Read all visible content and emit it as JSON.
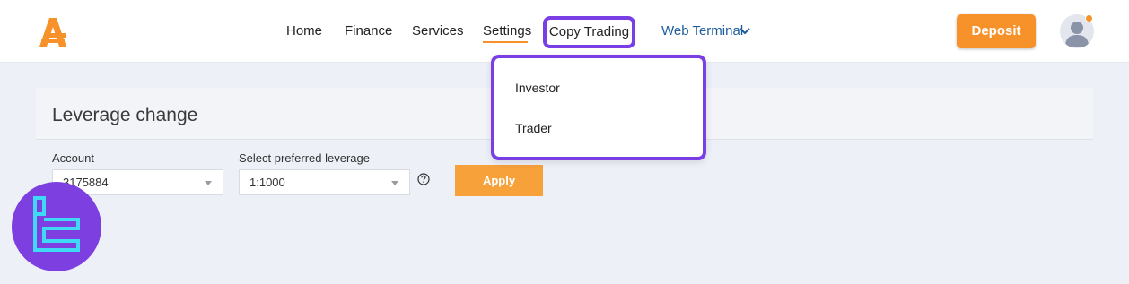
{
  "header": {
    "nav": {
      "home": "Home",
      "finance": "Finance",
      "services": "Services",
      "settings": "Settings",
      "copy_trading": "Copy Trading",
      "web_terminal": "Web Terminal"
    },
    "deposit_label": "Deposit",
    "icons": [
      "brand-logo-icon",
      "chevron-down-icon",
      "user-avatar-icon"
    ]
  },
  "dropdown": {
    "items": [
      "Investor",
      "Trader"
    ]
  },
  "form": {
    "title": "Leverage change",
    "account_label": "Account",
    "account_value": "3175884",
    "leverage_label": "Select preferred leverage",
    "leverage_value": "1:1000",
    "apply_label": "Apply",
    "help_icon": "question-circle-icon"
  },
  "colors": {
    "accent_orange": "#f7922a",
    "highlight_purple": "#7a3fe4",
    "link_blue": "#1d5d9b",
    "watermark_purple": "#7e3fe0",
    "watermark_cyan": "#3fd8f5"
  }
}
